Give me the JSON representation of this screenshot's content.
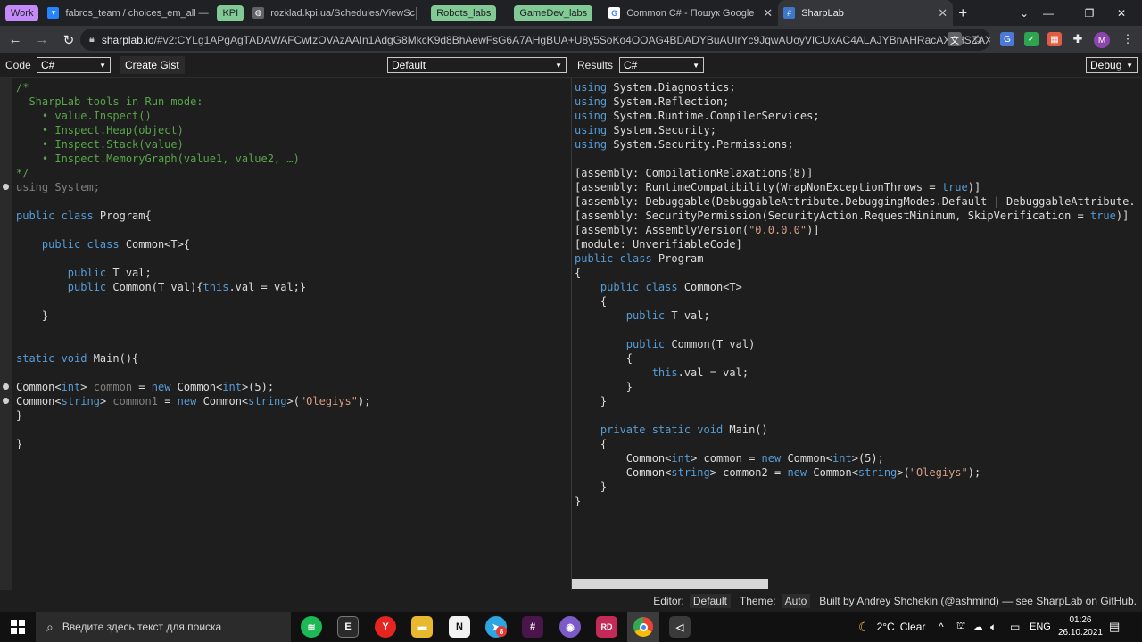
{
  "browser": {
    "tabs": [
      {
        "label": "fabros_team / choices_em_all — ...",
        "favicon": "bitbucket-icon",
        "color": "#2684ff"
      },
      {
        "label": "rozklad.kpi.ua/Schedules/ViewSc...",
        "favicon": "globe-icon",
        "color": "#9aa0a6"
      },
      {
        "label": "Common C# - Пошук Google",
        "favicon": "google-icon",
        "color": "#ffffff"
      },
      {
        "label": "SharpLab",
        "favicon": "sharplab-icon",
        "color": "#3c78c8"
      }
    ],
    "groups": [
      "Work",
      "KPI",
      "Robots_labs",
      "GameDev_labs"
    ],
    "group_colors": {
      "Work": "#c58af9",
      "KPI": "#81c995",
      "Robots_labs": "#81c995",
      "GameDev_labs": "#81c995"
    },
    "url_host": "sharplab.io",
    "url_rest": "/#v2:CYLg1APgAgTADAWAFCwIzOVAzAAIn1AdgG8MkcK9d8BhAewFsG6A7AHgBUA+U8y5SoKo4OOAG4BDADYBuAUIrYc9JqwAUoyVICUxAC4ALAJYBnAHRacAXnHSZAX3...",
    "profile_initial": "M"
  },
  "toolbar": {
    "code_label": "Code",
    "code_language": "C#",
    "create_gist": "Create Gist",
    "branch": "Default",
    "results_label": "Results",
    "results_language": "C#",
    "build_mode": "Debug"
  },
  "left_code": [
    [
      [
        "/*",
        "c"
      ]
    ],
    [
      [
        "  SharpLab tools in Run mode:",
        "c"
      ]
    ],
    [
      [
        "    • value.Inspect()",
        "c"
      ]
    ],
    [
      [
        "    • Inspect.Heap(object)",
        "c"
      ]
    ],
    [
      [
        "    • Inspect.Stack(value)",
        "c"
      ]
    ],
    [
      [
        "    • Inspect.MemoryGraph(value1, value2, …)",
        "c"
      ]
    ],
    [
      [
        "*/",
        "c"
      ]
    ],
    [
      [
        "using",
        "g"
      ],
      [
        " System;",
        "g"
      ]
    ],
    [
      [
        "",
        ""
      ]
    ],
    [
      [
        "public class",
        "k"
      ],
      [
        " Program{",
        ""
      ]
    ],
    [
      [
        "",
        ""
      ]
    ],
    [
      [
        "    ",
        ""
      ],
      [
        "public class",
        "k"
      ],
      [
        " Common<T>{",
        ""
      ]
    ],
    [
      [
        "",
        ""
      ]
    ],
    [
      [
        "        ",
        ""
      ],
      [
        "public",
        "k"
      ],
      [
        " T val;",
        ""
      ]
    ],
    [
      [
        "        ",
        ""
      ],
      [
        "public",
        "k"
      ],
      [
        " Common(T val){",
        ""
      ],
      [
        "this",
        "k"
      ],
      [
        ".val = val;}",
        ""
      ]
    ],
    [
      [
        "",
        ""
      ]
    ],
    [
      [
        "    }",
        ""
      ]
    ],
    [
      [
        "",
        ""
      ]
    ],
    [
      [
        "",
        ""
      ]
    ],
    [
      [
        "static void",
        "k"
      ],
      [
        " Main(){",
        ""
      ]
    ],
    [
      [
        "",
        ""
      ]
    ],
    [
      [
        "Common<",
        ""
      ],
      [
        "int",
        "k"
      ],
      [
        "> ",
        ""
      ],
      [
        "common",
        "g"
      ],
      [
        " = ",
        ""
      ],
      [
        "new",
        "k"
      ],
      [
        " Common<",
        ""
      ],
      [
        "int",
        "k"
      ],
      [
        ">(5);",
        ""
      ]
    ],
    [
      [
        "Common<",
        ""
      ],
      [
        "string",
        "k"
      ],
      [
        "> ",
        ""
      ],
      [
        "common1",
        "g"
      ],
      [
        " = ",
        ""
      ],
      [
        "new",
        "k"
      ],
      [
        " Common<",
        ""
      ],
      [
        "string",
        "k"
      ],
      [
        ">(",
        ""
      ],
      [
        "\"Olegiys\"",
        "s"
      ],
      [
        ");",
        ""
      ]
    ],
    [
      [
        "}",
        ""
      ]
    ],
    [
      [
        "",
        ""
      ]
    ],
    [
      [
        "}",
        ""
      ]
    ]
  ],
  "right_code": [
    [
      [
        "using",
        "k"
      ],
      [
        " System.Diagnostics;",
        ""
      ]
    ],
    [
      [
        "using",
        "k"
      ],
      [
        " System.Reflection;",
        ""
      ]
    ],
    [
      [
        "using",
        "k"
      ],
      [
        " System.Runtime.CompilerServices;",
        ""
      ]
    ],
    [
      [
        "using",
        "k"
      ],
      [
        " System.Security;",
        ""
      ]
    ],
    [
      [
        "using",
        "k"
      ],
      [
        " System.Security.Permissions;",
        ""
      ]
    ],
    [
      [
        "",
        ""
      ]
    ],
    [
      [
        "[assembly: CompilationRelaxations(8)]",
        ""
      ]
    ],
    [
      [
        "[assembly: RuntimeCompatibility(WrapNonExceptionThrows = ",
        ""
      ],
      [
        "true",
        "k"
      ],
      [
        ")]",
        ""
      ]
    ],
    [
      [
        "[assembly: Debuggable(DebuggableAttribute.DebuggingModes.Default | DebuggableAttribute.",
        ""
      ]
    ],
    [
      [
        "[assembly: SecurityPermission(SecurityAction.RequestMinimum, SkipVerification = ",
        ""
      ],
      [
        "true",
        "k"
      ],
      [
        ")]",
        ""
      ]
    ],
    [
      [
        "[assembly: AssemblyVersion(",
        ""
      ],
      [
        "\"0.0.0.0\"",
        "s"
      ],
      [
        ")]",
        ""
      ]
    ],
    [
      [
        "[module: UnverifiableCode]",
        ""
      ]
    ],
    [
      [
        "public class",
        "k"
      ],
      [
        " Program",
        ""
      ]
    ],
    [
      [
        "{",
        ""
      ]
    ],
    [
      [
        "    ",
        ""
      ],
      [
        "public class",
        "k"
      ],
      [
        " Common<T>",
        ""
      ]
    ],
    [
      [
        "    {",
        ""
      ]
    ],
    [
      [
        "        ",
        ""
      ],
      [
        "public",
        "k"
      ],
      [
        " T val;",
        ""
      ]
    ],
    [
      [
        "",
        ""
      ]
    ],
    [
      [
        "        ",
        ""
      ],
      [
        "public",
        "k"
      ],
      [
        " Common(T val)",
        ""
      ]
    ],
    [
      [
        "        {",
        ""
      ]
    ],
    [
      [
        "            ",
        ""
      ],
      [
        "this",
        "k"
      ],
      [
        ".val = val;",
        ""
      ]
    ],
    [
      [
        "        }",
        ""
      ]
    ],
    [
      [
        "    }",
        ""
      ]
    ],
    [
      [
        "",
        ""
      ]
    ],
    [
      [
        "    ",
        ""
      ],
      [
        "private static void",
        "k"
      ],
      [
        " Main()",
        ""
      ]
    ],
    [
      [
        "    {",
        ""
      ]
    ],
    [
      [
        "        Common<",
        ""
      ],
      [
        "int",
        "k"
      ],
      [
        "> common = ",
        ""
      ],
      [
        "new",
        "k"
      ],
      [
        " Common<",
        ""
      ],
      [
        "int",
        "k"
      ],
      [
        ">(5);",
        ""
      ]
    ],
    [
      [
        "        Common<",
        ""
      ],
      [
        "string",
        "k"
      ],
      [
        "> common2 = ",
        ""
      ],
      [
        "new",
        "k"
      ],
      [
        " Common<",
        ""
      ],
      [
        "string",
        "k"
      ],
      [
        ">(",
        ""
      ],
      [
        "\"Olegiys\"",
        "s"
      ],
      [
        ");",
        ""
      ]
    ],
    [
      [
        "    }",
        ""
      ]
    ],
    [
      [
        "}",
        ""
      ]
    ]
  ],
  "statusbar": {
    "editor_label": "Editor:",
    "editor_value": "Default",
    "theme_label": "Theme:",
    "theme_value": "Auto",
    "credits": "Built by Andrey Shchekin (@ashmind) — see SharpLab on GitHub."
  },
  "taskbar": {
    "search_placeholder": "Введите здесь текст для поиска",
    "weather_temp": "2°C",
    "weather_text": "Clear",
    "language": "ENG",
    "time": "01:26",
    "date": "26.10.2021",
    "apps": [
      {
        "name": "spotify-icon",
        "glyph": "≋",
        "color": "#1db954"
      },
      {
        "name": "epic-games-icon",
        "glyph": "E",
        "color": "#2a2a2a"
      },
      {
        "name": "yandex-browser-icon",
        "glyph": "Y",
        "color": "#e52620"
      },
      {
        "name": "file-explorer-icon",
        "glyph": "▬",
        "color": "#e8b92f"
      },
      {
        "name": "notion-icon",
        "glyph": "N",
        "color": "#f2f2f2"
      },
      {
        "name": "telegram-icon",
        "glyph": "➤",
        "color": "#2ca5e0"
      },
      {
        "name": "slack-icon",
        "glyph": "#",
        "color": "#4a154b"
      },
      {
        "name": "github-desktop-icon",
        "glyph": "◉",
        "color": "#7b5cc7"
      },
      {
        "name": "rider-icon",
        "glyph": "RD",
        "color": "#c22a57"
      },
      {
        "name": "chrome-icon",
        "glyph": "◎",
        "color": "#4285f4"
      },
      {
        "name": "visual-studio-icon",
        "glyph": "◁",
        "color": "#3a3a3a"
      }
    ],
    "telegram_badge": "8"
  }
}
